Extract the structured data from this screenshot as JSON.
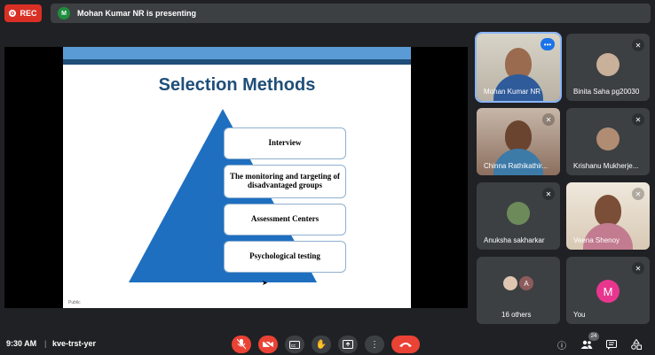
{
  "topbar": {
    "rec_label": "REC",
    "presenter_initial": "M",
    "presenting_text": "Mohan Kumar NR is presenting"
  },
  "slide": {
    "title": "Selection Methods",
    "items": [
      "Interview",
      "The monitoring and targeting of disadvantaged groups",
      "Assessment Centers",
      "Psychological testing"
    ],
    "footer": "Public",
    "colors": {
      "title": "#1f4e79",
      "pyramid": "#1f6fc0",
      "band": "#5b9bd5"
    }
  },
  "participants": [
    {
      "name": "Mohan Kumar NR",
      "kind": "video",
      "active_speaker": true
    },
    {
      "name": "Binita Saha pg20030",
      "kind": "avatar",
      "muted": true
    },
    {
      "name": "Chinna Rathikathir...",
      "kind": "video",
      "muted": true
    },
    {
      "name": "Krishanu Mukherje...",
      "kind": "avatar",
      "muted": true
    },
    {
      "name": "Anuksha sakharkar",
      "kind": "avatar",
      "muted": true
    },
    {
      "name": "Veena Shenoy",
      "kind": "video",
      "muted": true
    },
    {
      "name": "16 others",
      "kind": "group",
      "initial": "A"
    },
    {
      "name": "You",
      "kind": "initial",
      "initial": "M",
      "muted": true
    }
  ],
  "bottombar": {
    "time": "9:30 AM",
    "separator": "|",
    "meeting_code": "kve-trst-yer",
    "participant_count": "24"
  },
  "icons": {
    "mic_off": "mic-off-icon",
    "cam_off": "camera-off-icon",
    "captions": "captions-icon",
    "raise_hand": "raise-hand-icon",
    "present": "present-icon",
    "more": "more-vert-icon",
    "end_call": "end-call-icon",
    "info": "info-icon",
    "people": "people-icon",
    "chat": "chat-icon",
    "activities": "activities-icon"
  }
}
